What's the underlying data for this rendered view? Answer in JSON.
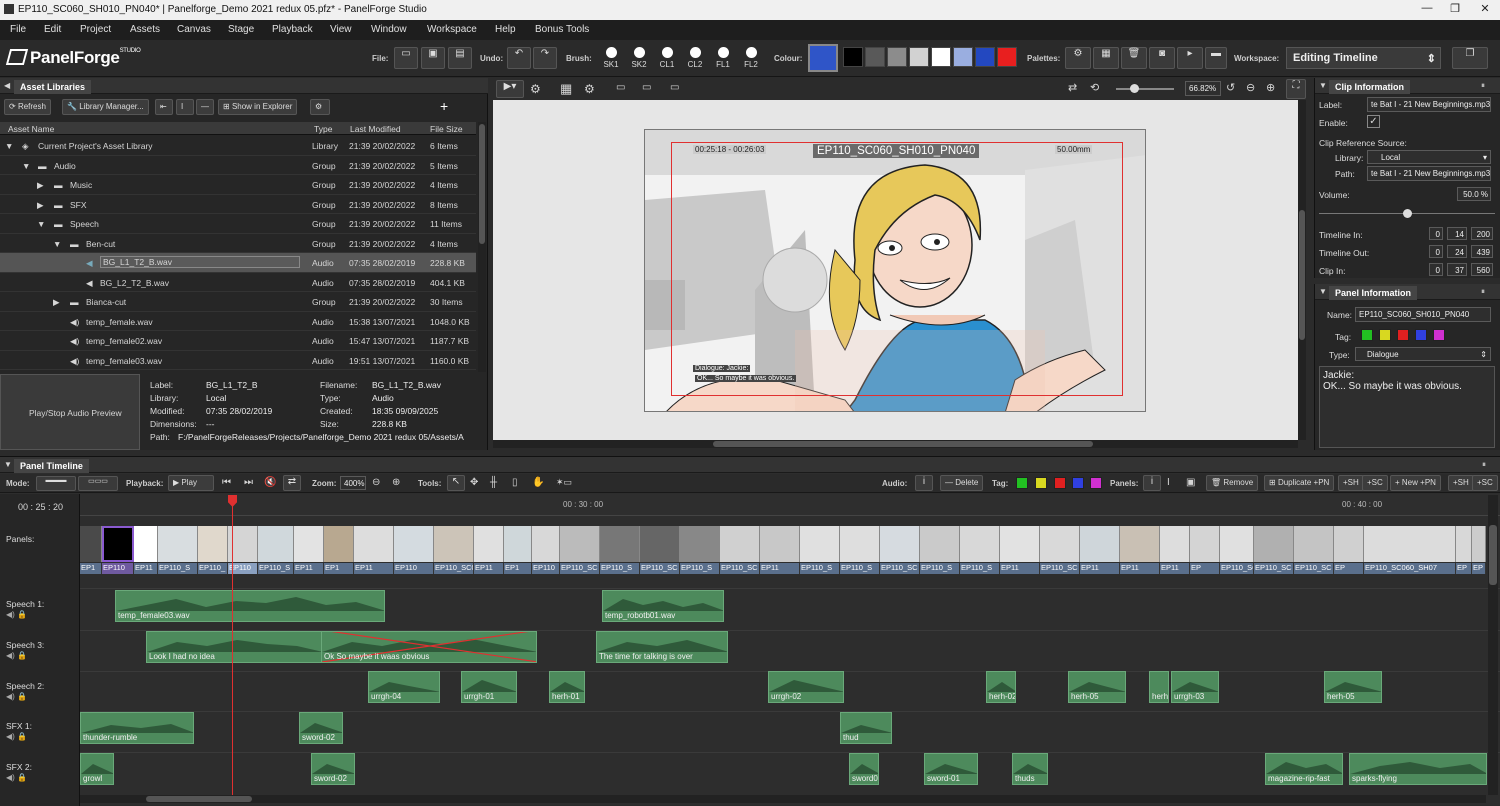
{
  "window": {
    "title": "EP110_SC060_SH010_PN040* | Panelforge_Demo 2021 redux 05.pfz* - PanelForge Studio"
  },
  "menu": [
    "File",
    "Edit",
    "Project",
    "Assets",
    "Canvas",
    "Stage",
    "Playback",
    "View",
    "Window",
    "Workspace",
    "Help",
    "Bonus Tools"
  ],
  "toolbar": {
    "logo": "PanelForge",
    "logo_sup": "STUDIO",
    "file": "File:",
    "undo": "Undo:",
    "brush": "Brush:",
    "brushes": [
      "SK1",
      "SK2",
      "CL1",
      "CL2",
      "FL1",
      "FL2"
    ],
    "colour": "Colour:",
    "colours": [
      "#2f55c8",
      "#000000",
      "#595959",
      "#8c8c8c",
      "#d2d2d2",
      "#ffffff",
      "#9aaee0",
      "#2348c0",
      "#e81f1f"
    ],
    "palettes": "Palettes:",
    "workspace": "Workspace:",
    "workspace_value": "Editing Timeline"
  },
  "assets": {
    "tab": "Asset Libraries",
    "refresh": "Refresh",
    "library_manager": "Library Manager...",
    "show_in_explorer": "Show in Explorer",
    "columns": [
      "Asset Name",
      "Type",
      "Last Modified",
      "File Size"
    ],
    "rows": [
      {
        "name": "Current Project's Asset Library",
        "type": "Library",
        "mod": "21:39  20/02/2022",
        "size": "6 Items"
      },
      {
        "name": "Audio",
        "type": "Group",
        "mod": "21:39  20/02/2022",
        "size": "5 Items"
      },
      {
        "name": "Music",
        "type": "Group",
        "mod": "21:39  20/02/2022",
        "size": "4 Items"
      },
      {
        "name": "SFX",
        "type": "Group",
        "mod": "21:39  20/02/2022",
        "size": "8 Items"
      },
      {
        "name": "Speech",
        "type": "Group",
        "mod": "21:39  20/02/2022",
        "size": "11 Items"
      },
      {
        "name": "Ben-cut",
        "type": "Group",
        "mod": "21:39  20/02/2022",
        "size": "4 Items"
      },
      {
        "name": "BG_L1_T2_B.wav",
        "type": "Audio",
        "mod": "07:35  28/02/2019",
        "size": "228.8 KB"
      },
      {
        "name": "BG_L2_T2_B.wav",
        "type": "Audio",
        "mod": "07:35  28/02/2019",
        "size": "404.1 KB"
      },
      {
        "name": "Bianca-cut",
        "type": "Group",
        "mod": "21:39  20/02/2022",
        "size": "30 Items"
      },
      {
        "name": "temp_female.wav",
        "type": "Audio",
        "mod": "15:38  13/07/2021",
        "size": "1048.0 KB"
      },
      {
        "name": "temp_female02.wav",
        "type": "Audio",
        "mod": "15:47  13/07/2021",
        "size": "1187.7 KB"
      },
      {
        "name": "temp_female03.wav",
        "type": "Audio",
        "mod": "19:51  13/07/2021",
        "size": "1160.0 KB"
      }
    ],
    "preview": "Play/Stop Audio Preview",
    "info": {
      "label_l": "Label:",
      "label": "BG_L1_T2_B",
      "library_l": "Library:",
      "library": "Local",
      "modified_l": "Modified:",
      "modified": "07:35  28/02/2019",
      "dimensions_l": "Dimensions:",
      "dimensions": "---",
      "path_l": "Path:",
      "path": "F:/PanelForgeReleases/Projects/Panelforge_Demo 2021 redux 05/Assets/A",
      "filename_l": "Filename:",
      "filename": "BG_L1_T2_B.wav",
      "type_l": "Type:",
      "type": "Audio",
      "created_l": "Created:",
      "created": "18:35  09/09/2025",
      "size_l": "Size:",
      "size": "228.8 KB"
    }
  },
  "canvas": {
    "zoom": "66.82%",
    "timecode": "00:25:18 - 00:26:03",
    "shot": "EP110_SC060_SH010_PN040",
    "lens": "50.00mm",
    "dialogue_tag": "Dialogue: Jackie:",
    "dialogue_text": "OK... So maybe it was obvious."
  },
  "clip_info": {
    "tab": "Clip Information",
    "label_l": "Label:",
    "label": "te Bat I - 21 New Beginnings.mp3",
    "enable_l": "Enable:",
    "ref_source": "Clip Reference Source:",
    "library_l": "Library:",
    "library": "Local",
    "path_l": "Path:",
    "path": "te Bat I - 21 New Beginnings.mp3",
    "volume_l": "Volume:",
    "volume": "50.0 %",
    "volume_level": 0.5,
    "tin_l": "Timeline In:",
    "tin": [
      "0",
      "14",
      "200"
    ],
    "tout_l": "Timeline Out:",
    "tout": [
      "0",
      "24",
      "439"
    ],
    "cin_l": "Clip In:",
    "cin": [
      "0",
      "37",
      "560"
    ]
  },
  "panel_info": {
    "tab": "Panel Information",
    "name_l": "Name:",
    "name": "EP110_SC060_SH010_PN040",
    "tag_l": "Tag:",
    "tags": [
      "#22c022",
      "#d8d820",
      "#e02020",
      "#3040e0",
      "#d030d0"
    ],
    "type_l": "Type:",
    "type": "Dialogue",
    "notes_1": "Jackie:",
    "notes_2": "OK... So maybe it was obvious."
  },
  "timeline": {
    "tab": "Panel Timeline",
    "mode": "Mode:",
    "playback": "Playback:",
    "play": "Play",
    "zoom": "Zoom:",
    "zoom_value": "400%",
    "tools": "Tools:",
    "audio": "Audio:",
    "delete": "Delete",
    "tag": "Tag:",
    "panels_l": "Panels:",
    "remove": "Remove",
    "duplicate": "Duplicate",
    "new": "New",
    "pn": "+PN",
    "sh": "+SH",
    "sc": "+SC",
    "timecode": "00 : 25 : 20",
    "ruler": [
      "00 : 30 : 00",
      "00 : 40 : 00"
    ],
    "panel_labels": [
      "EP1",
      "EP110",
      "EP11",
      "EP110_S",
      "EP110_",
      "EP110",
      "EP110_S",
      "EP11",
      "EP1",
      "EP11",
      "EP110",
      "EP110_SC0",
      "EP11",
      "EP1",
      "EP110",
      "EP110_SC",
      "EP110_S",
      "EP110_SC",
      "EP110_S",
      "EP110_SC",
      "EP11",
      "EP110_S",
      "EP110_S",
      "EP110_SC",
      "EP110_S",
      "EP110_S",
      "EP11",
      "EP110_SC",
      "EP11",
      "EP11",
      "EP11",
      "EP",
      "EP110_SC",
      "EP110_SC",
      "EP110_SC",
      "EP",
      "EP110_SC060_SH07",
      "EP",
      "EP"
    ],
    "tracks": [
      {
        "name": "Speech 1:",
        "clips": [
          {
            "label": "temp_female03.wav"
          },
          {
            "label": "temp_robotb01.wav"
          }
        ]
      },
      {
        "name": "Speech 3:",
        "clips": [
          {
            "label": "Look I had no idea"
          },
          {
            "label": "Ok So maybe it waas obvious"
          },
          {
            "label": "The time for talking is over"
          }
        ]
      },
      {
        "name": "Speech 2:",
        "clips": [
          {
            "label": "urrgh-04"
          },
          {
            "label": "urrgh-01"
          },
          {
            "label": "herh-01"
          },
          {
            "label": "urrgh-02"
          },
          {
            "label": "herh-02"
          },
          {
            "label": "herh-05"
          },
          {
            "label": "herh"
          },
          {
            "label": "urrgh-03"
          },
          {
            "label": "herh-05"
          }
        ]
      },
      {
        "name": "SFX 1:",
        "clips": [
          {
            "label": "thunder-rumble"
          },
          {
            "label": "sword-02"
          },
          {
            "label": "thud"
          }
        ]
      },
      {
        "name": "SFX 2:",
        "clips": [
          {
            "label": "growl"
          },
          {
            "label": "sword-02"
          },
          {
            "label": "sword0"
          },
          {
            "label": "sword-01"
          },
          {
            "label": "thuds"
          },
          {
            "label": "magazine-rip-fast"
          },
          {
            "label": "sparks-flying"
          }
        ]
      }
    ]
  }
}
